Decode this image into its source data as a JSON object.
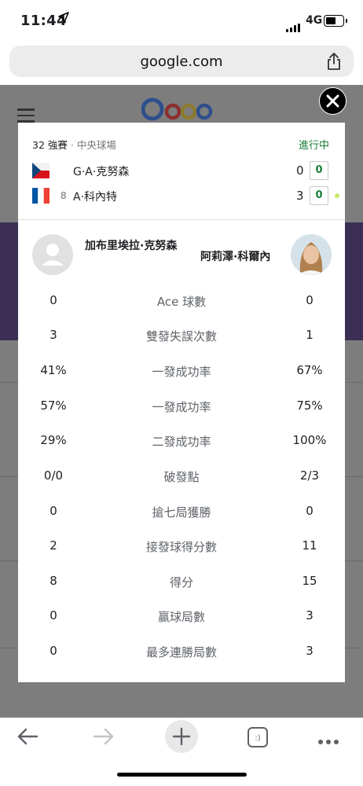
{
  "status_bar": {
    "time": "11:44",
    "network": "4G"
  },
  "browser": {
    "url": "google.com"
  },
  "match": {
    "round": "32 強賽",
    "court": "· 中央球場",
    "state": "進行中",
    "players": [
      {
        "short_name": "G·A·克努森",
        "seed": "",
        "sets": "0",
        "games": "0",
        "flag": "czech"
      },
      {
        "short_name": "A·科內特",
        "seed": "8",
        "sets": "3",
        "games": "0",
        "flag": "france"
      }
    ]
  },
  "head_to_head": {
    "player1_full": "加布里埃拉·克努森",
    "player2_full": "阿莉澤·科爾內"
  },
  "stats": [
    {
      "label": "Ace 球數",
      "p1": "0",
      "p2": "0"
    },
    {
      "label": "雙發失誤次數",
      "p1": "3",
      "p2": "1"
    },
    {
      "label": "一發成功率",
      "p1": "41%",
      "p2": "67%"
    },
    {
      "label": "一發成功率",
      "p1": "57%",
      "p2": "75%"
    },
    {
      "label": "二發成功率",
      "p1": "29%",
      "p2": "100%"
    },
    {
      "label": "破發點",
      "p1": "0/0",
      "p2": "2/3"
    },
    {
      "label": "搶七局獲勝",
      "p1": "0",
      "p2": "0"
    },
    {
      "label": "接發球得分數",
      "p1": "2",
      "p2": "11"
    },
    {
      "label": "得分",
      "p1": "8",
      "p2": "15"
    },
    {
      "label": "贏球局數",
      "p1": "0",
      "p2": "3"
    },
    {
      "label": "最多連勝局數",
      "p1": "0",
      "p2": "3"
    }
  ],
  "icons": [
    "location-arrow-icon",
    "signal-icon",
    "battery-icon",
    "share-icon",
    "close-icon",
    "back-icon",
    "forward-icon",
    "new-tab-icon",
    "tabs-icon",
    "more-icon"
  ]
}
